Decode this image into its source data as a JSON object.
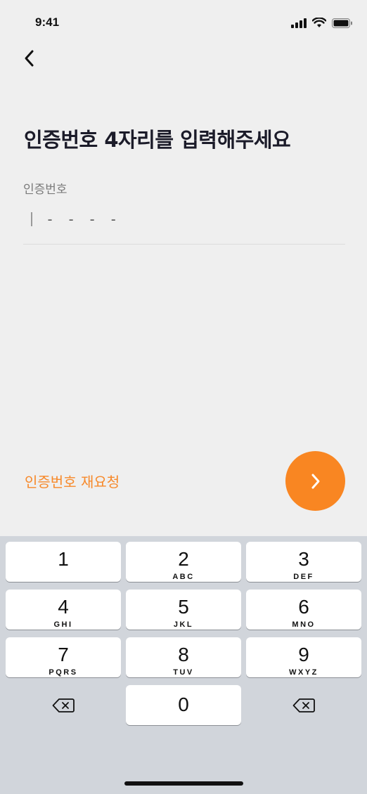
{
  "status_bar": {
    "time": "9:41"
  },
  "header": {
    "back_icon": "chevron-left-icon"
  },
  "title": "인증번호 4자리를 입력해주세요",
  "field": {
    "label": "인증번호",
    "placeholder": "- - - -"
  },
  "resend_label": "인증번호 재요청",
  "next_icon": "chevron-right-icon",
  "colors": {
    "accent": "#f98622",
    "resend": "#f7892a",
    "background": "#efefef",
    "keyboard_bg": "#d1d5db"
  },
  "keypad": {
    "k1": {
      "digit": "1",
      "letters": ""
    },
    "k2": {
      "digit": "2",
      "letters": "ABC"
    },
    "k3": {
      "digit": "3",
      "letters": "DEF"
    },
    "k4": {
      "digit": "4",
      "letters": "GHI"
    },
    "k5": {
      "digit": "5",
      "letters": "JKL"
    },
    "k6": {
      "digit": "6",
      "letters": "MNO"
    },
    "k7": {
      "digit": "7",
      "letters": "PQRS"
    },
    "k8": {
      "digit": "8",
      "letters": "TUV"
    },
    "k9": {
      "digit": "9",
      "letters": "WXYZ"
    },
    "k0": {
      "digit": "0",
      "letters": ""
    }
  }
}
